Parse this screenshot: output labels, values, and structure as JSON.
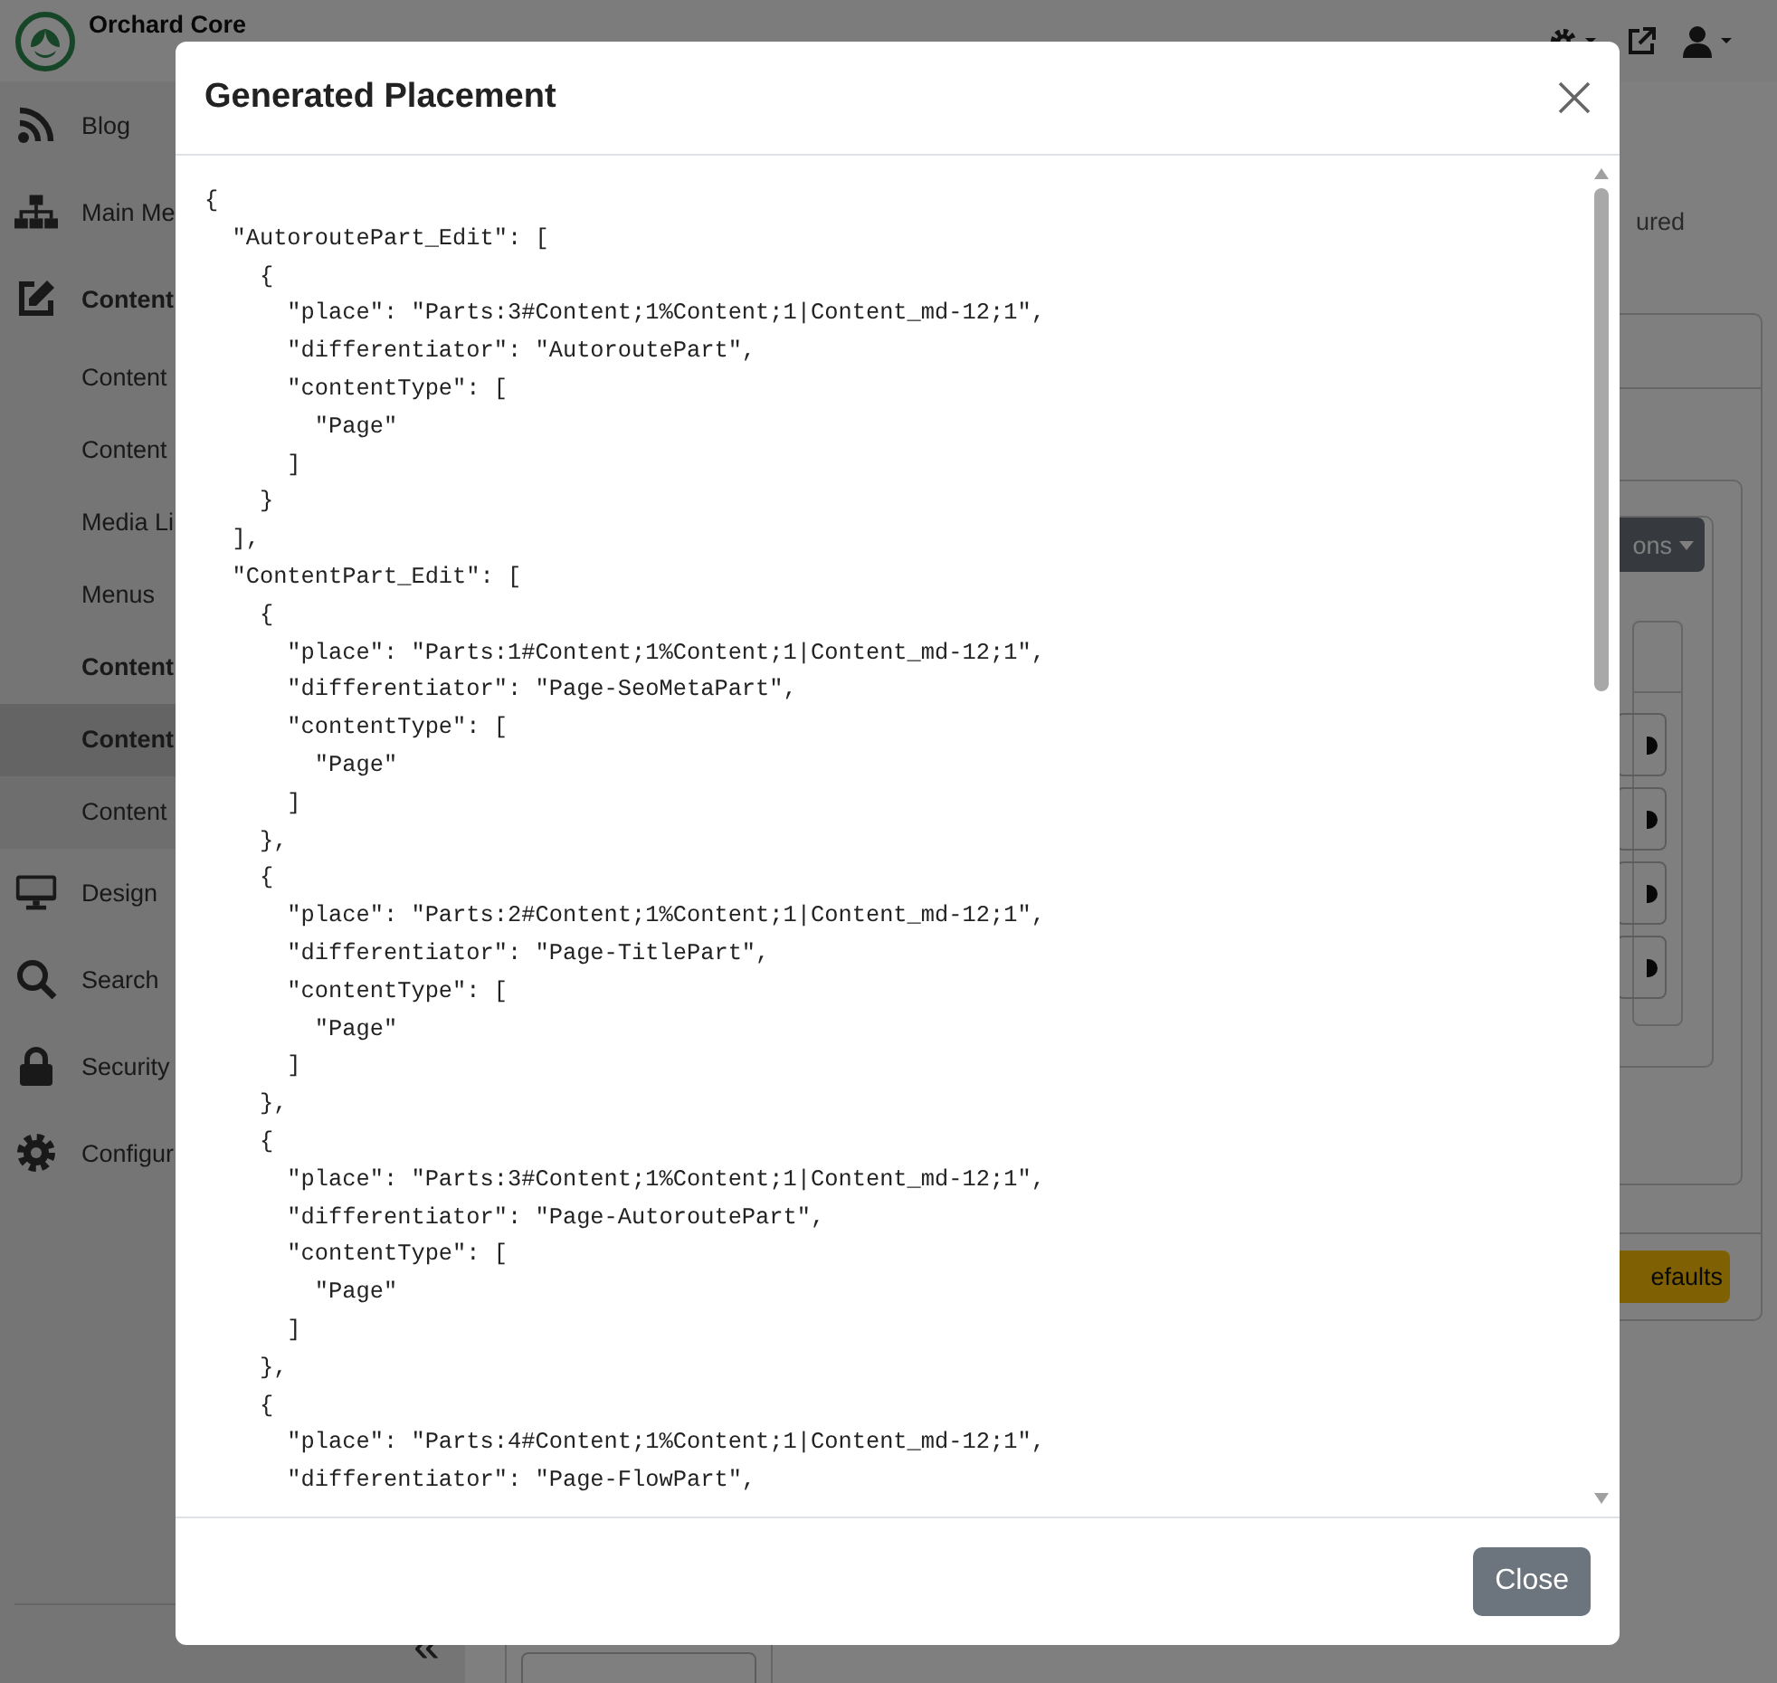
{
  "navbar": {
    "brand": "Orchard Core"
  },
  "sidebar": {
    "items": [
      {
        "label": "Blog",
        "expanded": false,
        "selected": false
      },
      {
        "label": "Main Me",
        "expanded": false,
        "selected": false
      },
      {
        "label": "Content",
        "expanded": true,
        "selected": false,
        "children": [
          {
            "label": "Content",
            "selected": false
          },
          {
            "label": "Content",
            "selected": false
          },
          {
            "label": "Media Li",
            "selected": false
          },
          {
            "label": "Menus",
            "selected": false
          },
          {
            "label": "Content",
            "expanded": true,
            "selected": false,
            "children": [
              {
                "label": "Content",
                "selected": true
              },
              {
                "label": "Content",
                "selected": false
              }
            ]
          }
        ]
      },
      {
        "label": "Design",
        "expanded": false,
        "selected": false
      },
      {
        "label": "Search",
        "expanded": false,
        "selected": false
      },
      {
        "label": "Security",
        "expanded": false,
        "selected": false
      },
      {
        "label": "Configur",
        "expanded": false,
        "selected": false
      }
    ],
    "collapse_label": "«"
  },
  "main": {
    "partial_text": "ured",
    "actions_button": "ons",
    "defaults_button": "efaults"
  },
  "modal": {
    "title": "Generated Placement",
    "code_lines": [
      "{",
      "  \"AutoroutePart_Edit\": [",
      "    {",
      "      \"place\": \"Parts:3#Content;1%Content;1|Content_md-12;1\",",
      "      \"differentiator\": \"AutoroutePart\",",
      "      \"contentType\": [",
      "        \"Page\"",
      "      ]",
      "    }",
      "  ],",
      "  \"ContentPart_Edit\": [",
      "    {",
      "      \"place\": \"Parts:1#Content;1%Content;1|Content_md-12;1\",",
      "      \"differentiator\": \"Page-SeoMetaPart\",",
      "      \"contentType\": [",
      "        \"Page\"",
      "      ]",
      "    },",
      "    {",
      "      \"place\": \"Parts:2#Content;1%Content;1|Content_md-12;1\",",
      "      \"differentiator\": \"Page-TitlePart\",",
      "      \"contentType\": [",
      "        \"Page\"",
      "      ]",
      "    },",
      "    {",
      "      \"place\": \"Parts:3#Content;1%Content;1|Content_md-12;1\",",
      "      \"differentiator\": \"Page-AutoroutePart\",",
      "      \"contentType\": [",
      "        \"Page\"",
      "      ]",
      "    },",
      "    {",
      "      \"place\": \"Parts:4#Content;1%Content;1|Content_md-12;1\",",
      "      \"differentiator\": \"Page-FlowPart\","
    ],
    "close_button": "Close"
  }
}
